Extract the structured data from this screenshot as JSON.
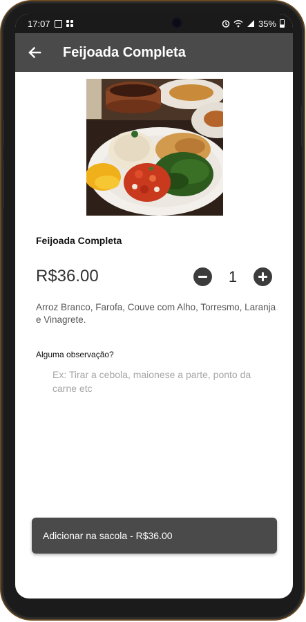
{
  "status_bar": {
    "time": "17:07",
    "battery": "35%",
    "icons": [
      "image-icon",
      "app-grid-icon",
      "alarm-icon",
      "wifi-icon",
      "signal-icon",
      "battery-icon"
    ]
  },
  "app_bar": {
    "title": "Feijoada Completa",
    "back_icon": "arrow-left-icon",
    "background": "#4a4a4a"
  },
  "product": {
    "name": "Feijoada Completa",
    "price": "R$36.00",
    "quantity": "1",
    "description": "Arroz Branco, Farofa, Couve com Alho, Torresmo, Laranja e Vinagrete."
  },
  "observation": {
    "label": "Alguma observação?",
    "placeholder": "Ex: Tirar a cebola, maionese a parte, ponto da carne etc",
    "value": ""
  },
  "cart_button": {
    "label": "Adicionar na sacola - R$36.00"
  },
  "colors": {
    "app_bar": "#4a4a4a",
    "button": "#4a4a4a",
    "qty_buttons": "#3c3c3c"
  }
}
